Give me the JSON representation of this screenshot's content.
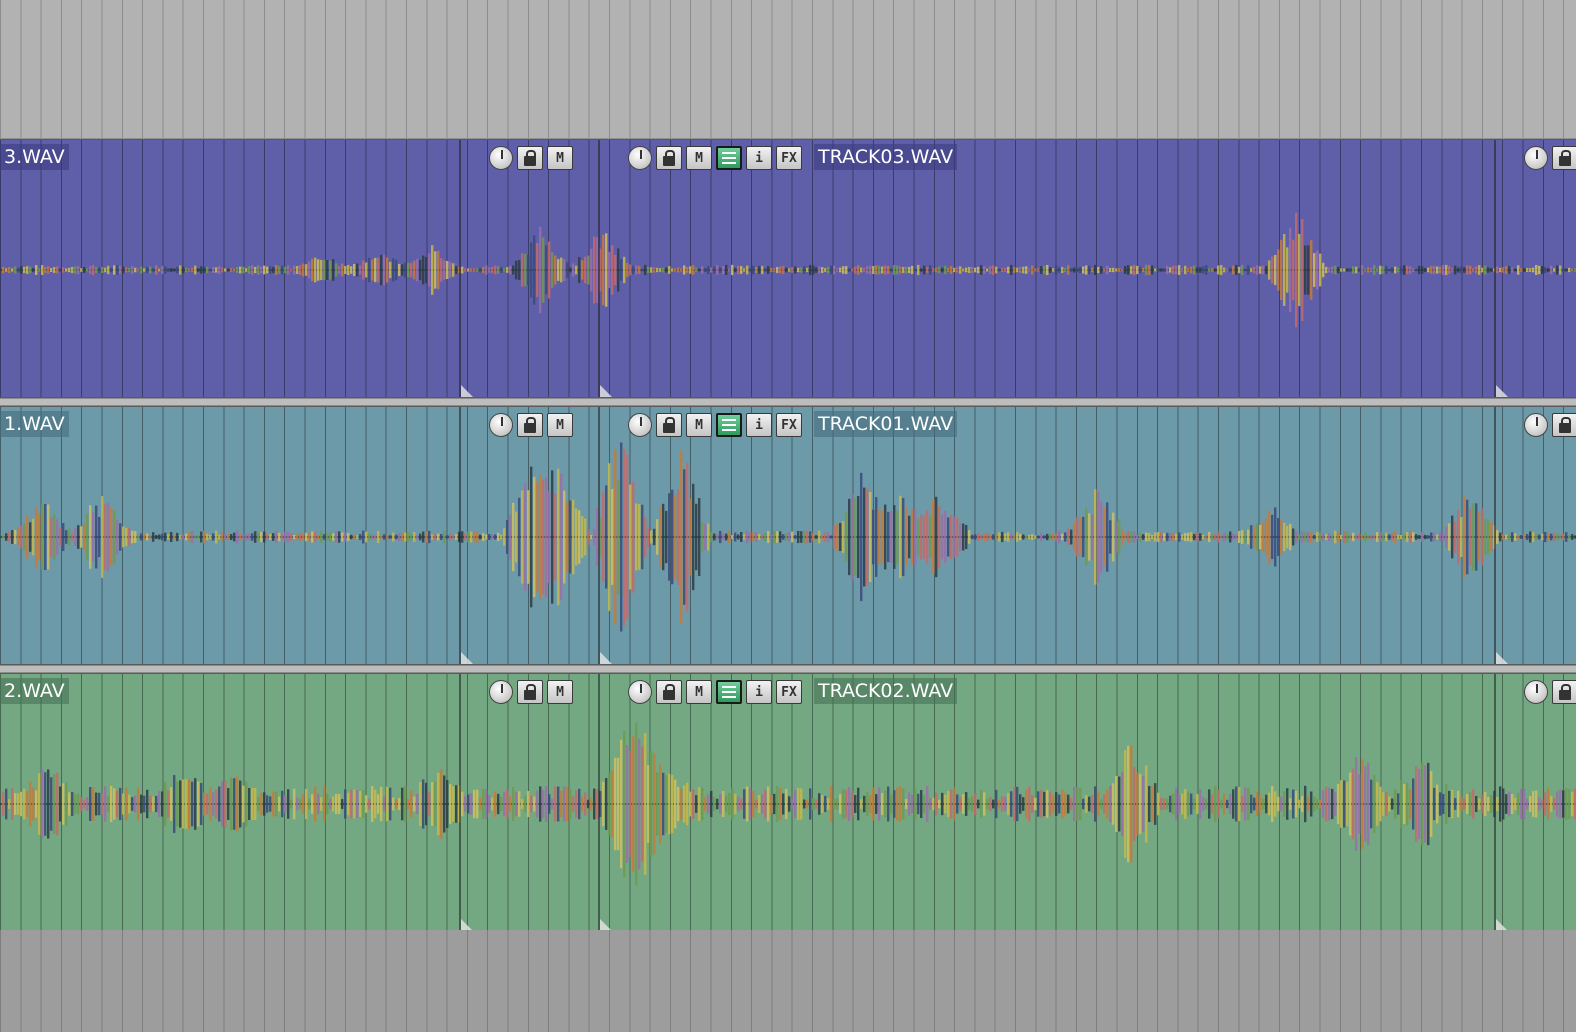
{
  "lanes": [
    {
      "id": "track03",
      "color": "#5f5fa9",
      "left_label": "3.WAV",
      "clip_label": "TRACK03.WAV"
    },
    {
      "id": "track01",
      "color": "#6c9aa9",
      "left_label": "1.WAV",
      "clip_label": "TRACK01.WAV"
    },
    {
      "id": "track02",
      "color": "#73a883",
      "left_label": "2.WAV",
      "clip_label": "TRACK02.WAV"
    }
  ],
  "clip_buttons": {
    "mute": "M",
    "info": "i",
    "fx": "FX"
  }
}
